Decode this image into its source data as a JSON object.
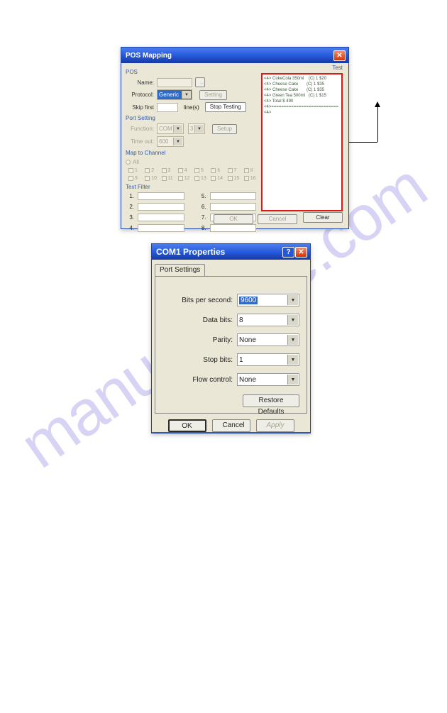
{
  "watermark": "manualshive.com",
  "win1": {
    "title": "POS Mapping",
    "pos": {
      "group": "POS",
      "name_label": "Name:",
      "name_value": "",
      "protocol_label": "Protocol:",
      "protocol_value": "Generic",
      "setting_btn": "Setting",
      "skip_label": "Skip first",
      "skip_value": "",
      "skip_suffix": "line(s)",
      "stop_btn": "Stop Testing"
    },
    "port": {
      "group": "Port Setting",
      "fun_label": "Function:",
      "fun_value": "COM",
      "port_label": "",
      "port_value": "3",
      "setup_btn": "Setup",
      "timeout_label": "Time out:",
      "timeout_value": "600"
    },
    "map": {
      "group": "Map to Channel",
      "radios": [
        "All"
      ],
      "cells": [
        "1",
        "2",
        "3",
        "4",
        "5",
        "6",
        "7",
        "8",
        "9",
        "10",
        "11",
        "12",
        "13",
        "14",
        "15",
        "16"
      ]
    },
    "filter": {
      "group": "Text Filter",
      "labels": [
        "1.",
        "2.",
        "3.",
        "4.",
        "5.",
        "6.",
        "7.",
        "8."
      ]
    },
    "test": {
      "group": "Test",
      "lines": [
        "<4> CokeCola 350ml    (C) 1 $20",
        "<4> Cheese Cake       (C) 1 $35",
        "<4> Cheese Cake       (C) 1 $35",
        "<4> Green Tea 500ml   (C) 1 $15",
        "<4> Total $ 490",
        "<4>===========================",
        "<4>"
      ]
    },
    "buttons": {
      "ok": "OK",
      "cancel": "Cancel",
      "clear": "Clear"
    }
  },
  "win2": {
    "title": "COM1 Properties",
    "tab": "Port Settings",
    "fields": {
      "bits_per_second": {
        "label": "Bits per second:",
        "value": "9600"
      },
      "data_bits": {
        "label": "Data bits:",
        "value": "8"
      },
      "parity": {
        "label": "Parity:",
        "value": "None"
      },
      "stop_bits": {
        "label": "Stop bits:",
        "value": "1"
      },
      "flow_control": {
        "label": "Flow control:",
        "value": "None"
      }
    },
    "restore": "Restore Defaults",
    "ok": "OK",
    "cancel": "Cancel",
    "apply": "Apply"
  }
}
